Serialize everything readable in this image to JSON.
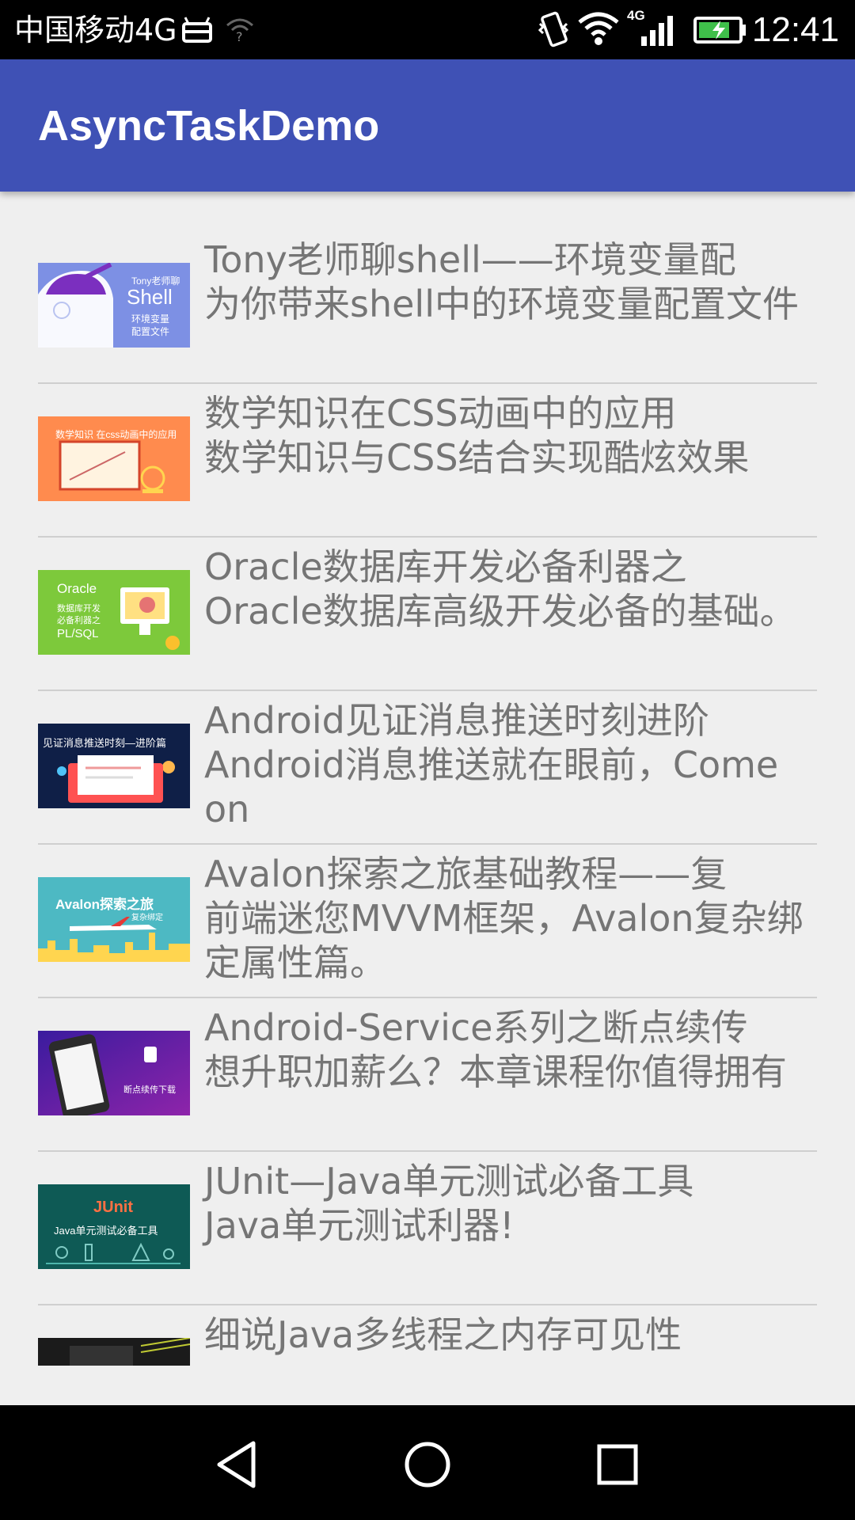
{
  "status_bar": {
    "carrier": "中国移动4G",
    "network": "4G",
    "time": "12:41"
  },
  "app_bar": {
    "title": "AsyncTaskDemo"
  },
  "items": [
    {
      "title": "Tony老师聊shell——环境变量配",
      "description": "为你带来shell中的环境变量配置文件",
      "thumb_text": [
        "Tony老师聊",
        "Shell",
        "环境变量",
        "配置文件"
      ],
      "thumb_color": "#6f83d9"
    },
    {
      "title": "数学知识在CSS动画中的应用",
      "description": "数学知识与CSS结合实现酷炫效果",
      "thumb_text": [
        "数学知识 在css动画中的应用"
      ],
      "thumb_color": "#ff8a4c"
    },
    {
      "title": "Oracle数据库开发必备利器之",
      "description": "Oracle数据库高级开发必备的基础。",
      "thumb_text": [
        "Oracle",
        "数据库开发",
        "必备利器之",
        "PL/SQL"
      ],
      "thumb_color": "#7ec93a"
    },
    {
      "title": "Android见证消息推送时刻进阶",
      "description": "Android消息推送就在眼前，Come on",
      "thumb_text": [
        "见证消息推送时刻—进阶篇"
      ],
      "thumb_color": "#10204a"
    },
    {
      "title": "Avalon探索之旅基础教程——复",
      "description": "前端迷您MVVM框架，Avalon复杂绑定属性篇。",
      "thumb_text": [
        "Avalon探索之旅",
        "复杂绑定"
      ],
      "thumb_color": "#4cb8c4"
    },
    {
      "title": "Android-Service系列之断点续传",
      "description": "想升职加薪么？本章课程你值得拥有",
      "thumb_text": [
        "断点续传下载"
      ],
      "thumb_color": "#5a1fa8"
    },
    {
      "title": "JUnit—Java单元测试必备工具",
      "description": "Java单元测试利器!",
      "thumb_text": [
        "JUnit",
        "Java单元测试必备工具"
      ],
      "thumb_color": "#0f5a55"
    },
    {
      "title": "细说Java多线程之内存可见性",
      "description": "",
      "thumb_text": [],
      "thumb_color": "#1a1a1a"
    }
  ],
  "colors": {
    "app_bar": "#3f51b5",
    "background": "#efefef",
    "text": "#757575",
    "divider": "#cfcfcf"
  }
}
